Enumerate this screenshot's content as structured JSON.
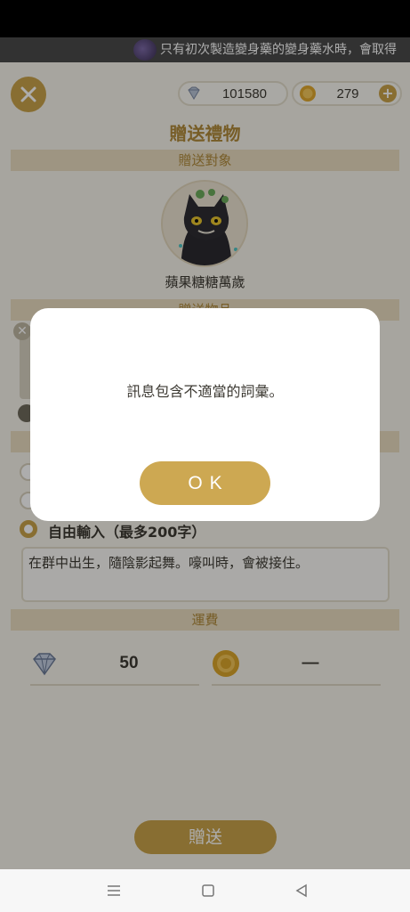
{
  "ticker": {
    "text": "只有初次製造變身藥的變身藥水時，會取得"
  },
  "currency": {
    "gems": "101580",
    "coins": "279",
    "plus": "+"
  },
  "page": {
    "title": "贈送禮物"
  },
  "sections": {
    "recipient": "贈送對象",
    "item": "贈送物品",
    "shipping": "運費"
  },
  "recipient": {
    "name": "蘋果糖糖萬歲"
  },
  "message": {
    "option_label": "自由輸入（最多200字）",
    "text": "在群中出生，隨陰影起舞。嚎叫時，會被接住。"
  },
  "shipping": {
    "gems_cost": "50",
    "coins_cost": "—"
  },
  "actions": {
    "send": "贈送",
    "remove": "✕"
  },
  "dialog": {
    "message": "訊息包含不適當的詞彙。",
    "ok": "OK"
  },
  "colors": {
    "accent": "#c9a24a",
    "section_bg": "#e9dcc0",
    "title": "#b08a3a"
  }
}
